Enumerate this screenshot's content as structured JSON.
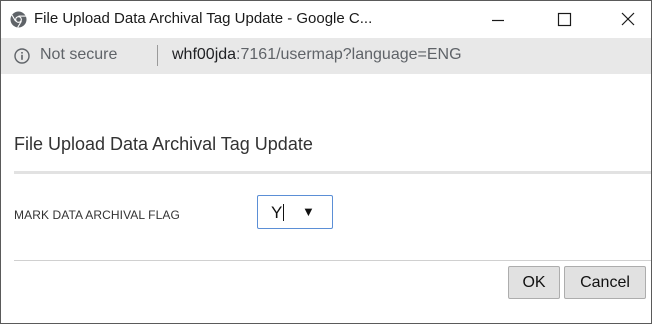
{
  "window": {
    "title": "File Upload Data Archival Tag Update - Google C...",
    "controls": {
      "minimize_icon": "minimize-icon",
      "maximize_icon": "maximize-icon",
      "close_icon": "close-icon"
    }
  },
  "address_bar": {
    "security_icon": "info-icon",
    "security_label": "Not secure",
    "url_host": "whf00jda",
    "url_rest": ":7161/usermap?language=ENG"
  },
  "page": {
    "title": "File Upload Data Archival Tag Update",
    "field": {
      "label": "MARK DATA ARCHIVAL FLAG",
      "selected_value": "Y",
      "dropdown_icon": "dropdown-arrow-icon"
    },
    "buttons": {
      "ok_label": "OK",
      "cancel_label": "Cancel"
    }
  },
  "colors": {
    "focus_border": "#5b8fd6",
    "address_bar_bg": "#e8e8e8",
    "button_bg": "#e1e1e1"
  }
}
